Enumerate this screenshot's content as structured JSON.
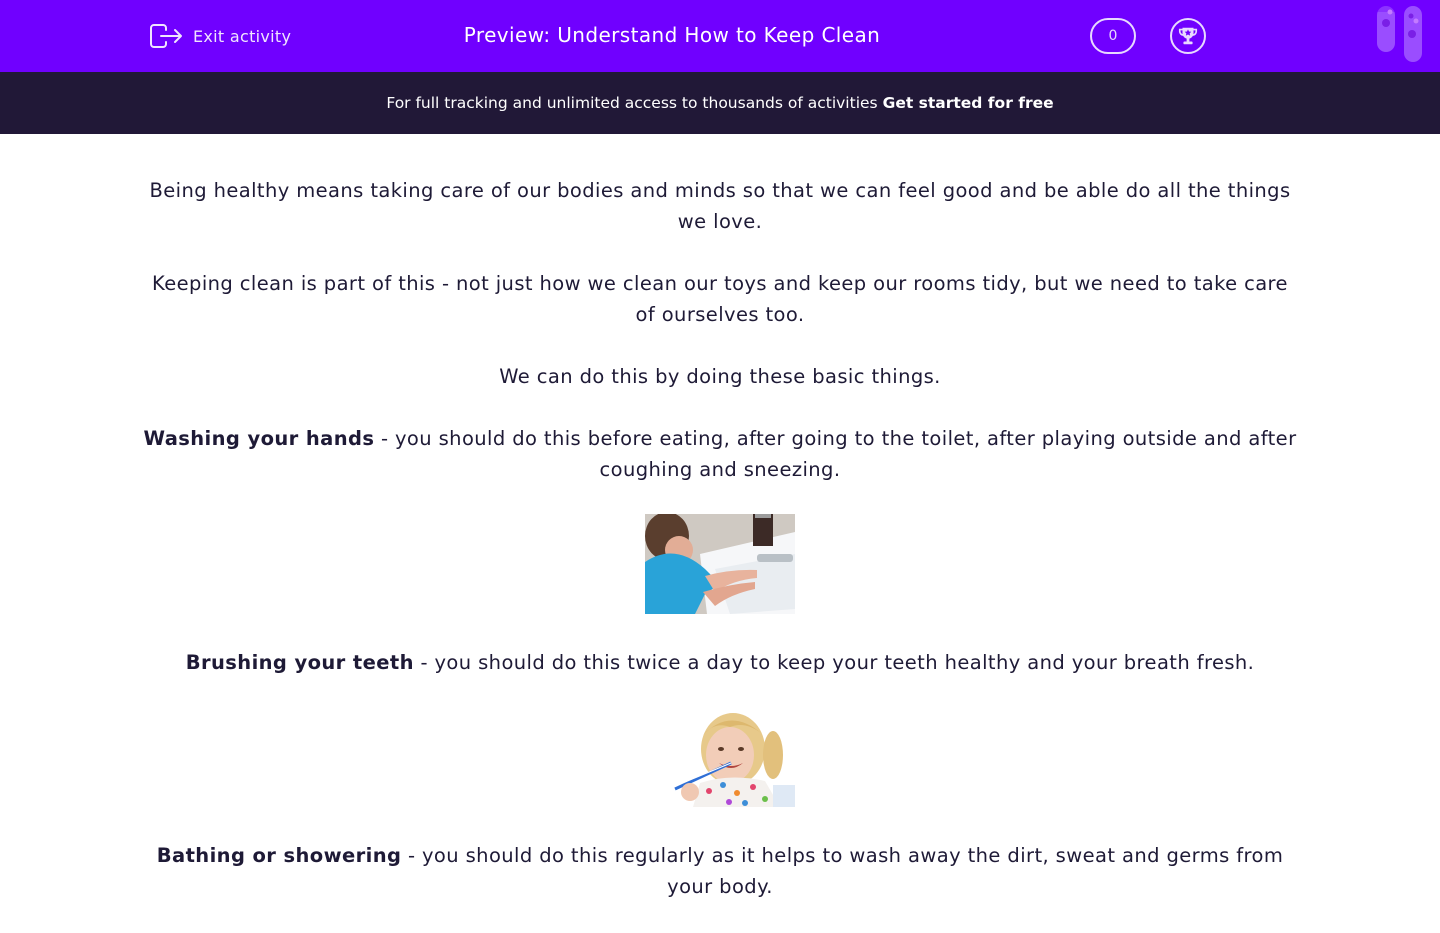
{
  "header": {
    "exit_label": "Exit activity",
    "title": "Preview: Understand How to Keep Clean",
    "score": "0",
    "icons": [
      "exit-icon",
      "trophy-icon",
      "test-tubes-icon"
    ],
    "colors": {
      "primary": "#7000ff",
      "banner": "#211837",
      "text": "#1e1a36"
    }
  },
  "banner": {
    "text": "For full tracking and unlimited access to thousands of activities",
    "cta": "Get started for free"
  },
  "content": {
    "para1": "Being healthy means taking care of our bodies and minds so that we can feel good and be able do all the things we love.",
    "para2": "Keeping clean is part of this - not just how we clean our toys and keep our rooms tidy, but we need to take care of ourselves too.",
    "para3": "We can do this by doing these basic things.",
    "items": [
      {
        "term": "Washing your hands",
        "desc": " - you should do this before eating, after going to the toilet, after playing outside and after coughing and sneezing.",
        "image": "boy washing hands at sink"
      },
      {
        "term": "Brushing your teeth",
        "desc": " - you should do this twice a day to keep your teeth healthy and your breath fresh.",
        "image": "girl brushing teeth"
      },
      {
        "term": "Bathing or showering",
        "desc": " - you should do this regularly as it helps to wash away the dirt, sweat and germs from your body."
      }
    ]
  }
}
